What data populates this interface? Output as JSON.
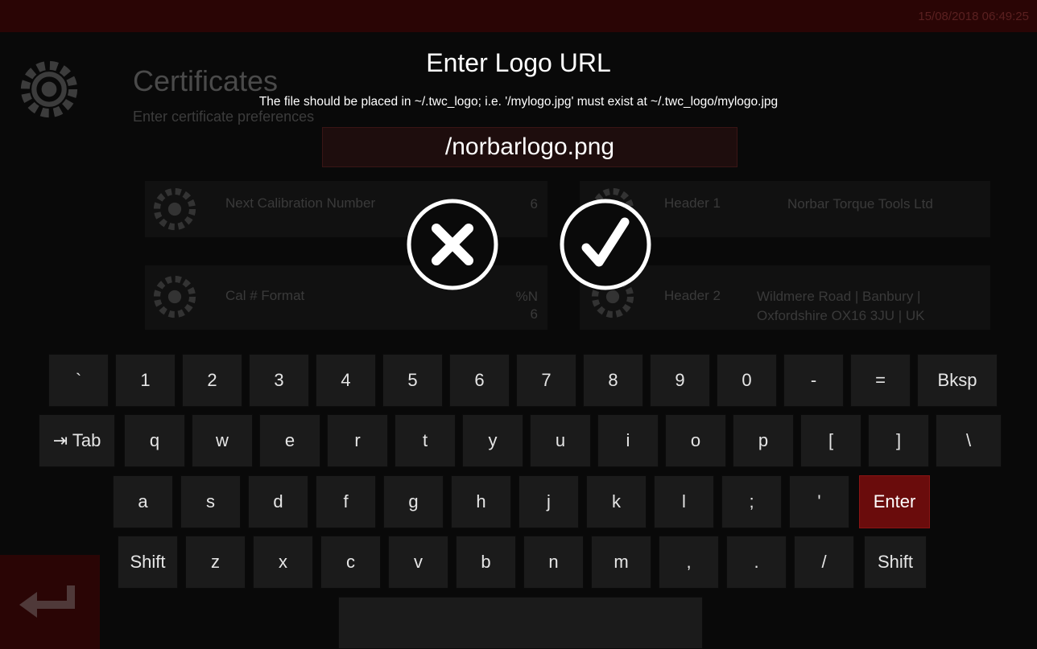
{
  "app": {
    "clock": "15/08/2018 06:49:25",
    "page_title": "Certificates",
    "page_subtitle": "Enter certificate preferences",
    "settings": [
      {
        "label": "Next Calibration Number",
        "value": "6"
      },
      {
        "label": "Header 1",
        "value": "Norbar Torque Tools Ltd"
      },
      {
        "label": "Cal # Format",
        "value_line1": "%N",
        "value_line2": "6"
      },
      {
        "label": "Header 2",
        "value_line1": "Wildmere Road | Banbury |",
        "value_line2": "Oxfordshire OX16 3JU | UK"
      }
    ]
  },
  "dialog": {
    "title": "Enter Logo URL",
    "hint": "The file should be placed in ~/.twc_logo; i.e. '/mylogo.jpg' must exist at ~/.twc_logo/mylogo.jpg",
    "input_value": "/norbarlogo.png",
    "cancel_icon": "close-icon",
    "confirm_icon": "check-icon"
  },
  "keyboard": {
    "rows": [
      [
        "`",
        "1",
        "2",
        "3",
        "4",
        "5",
        "6",
        "7",
        "8",
        "9",
        "0",
        "-",
        "=",
        "Bksp"
      ],
      [
        "⇥ Tab",
        "q",
        "w",
        "e",
        "r",
        "t",
        "y",
        "u",
        "i",
        "o",
        "p",
        "[",
        "]",
        "\\"
      ],
      [
        "a",
        "s",
        "d",
        "f",
        "g",
        "h",
        "j",
        "k",
        "l",
        ";",
        "'",
        "Enter"
      ],
      [
        "Shift",
        "z",
        "x",
        "c",
        "v",
        "b",
        "n",
        "m",
        ",",
        ".",
        "/",
        "Shift"
      ],
      [
        " "
      ]
    ]
  },
  "colors": {
    "accent_red": "#6a0c0c",
    "topbar": "#2a0505",
    "key": "#1b1b1b"
  }
}
